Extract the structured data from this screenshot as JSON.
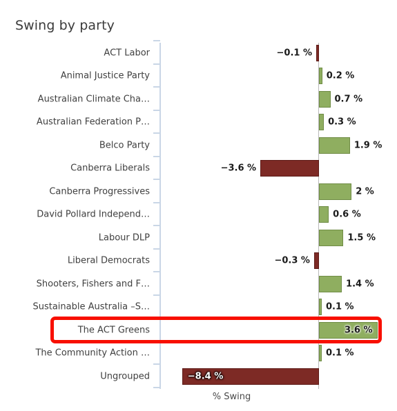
{
  "chart_data": {
    "type": "bar",
    "orientation": "horizontal",
    "title": "Swing by party",
    "xlabel": "% Swing",
    "ylabel": "",
    "grid": false,
    "legend": "none",
    "value_suffix": "%",
    "xlim": [
      -8.4,
      3.6
    ],
    "zero_line": true,
    "colors": {
      "positive": "#8fae60",
      "positive_border": "#6f8c45",
      "negative": "#7d2a25",
      "negative_border": "#5d1b17",
      "axis": "#c9d6e6",
      "zero_line": "#b9b9b9",
      "highlight": "#f80f00",
      "text": "#3f3f3f"
    },
    "highlight_category": "The ACT Greens",
    "categories": [
      "ACT Labor",
      "Animal Justice Party",
      "Australian Climate Cha…",
      "Australian Federation P…",
      "Belco Party",
      "Canberra Liberals",
      "Canberra Progressives",
      "David Pollard Independ…",
      "Labour DLP",
      "Liberal Democrats",
      "Shooters, Fishers and F…",
      "Sustainable Australia –S…",
      "The ACT Greens",
      "The Community Action …",
      "Ungrouped"
    ],
    "values": [
      -0.1,
      0.2,
      0.7,
      0.3,
      1.9,
      -3.6,
      2,
      0.6,
      1.5,
      -0.3,
      1.4,
      0.1,
      3.6,
      0.1,
      -8.4
    ],
    "value_labels": [
      "−0.1 %",
      "0.2 %",
      "0.7 %",
      "0.3 %",
      "1.9 %",
      "−3.6 %",
      "2 %",
      "0.6 %",
      "1.5 %",
      "−0.3 %",
      "1.4 %",
      "0.1 %",
      "3.6 %",
      "0.1 %",
      "−8.4 %"
    ]
  },
  "rows": [
    {
      "label": "ACT Labor",
      "value_label": "−0.1 %"
    },
    {
      "label": "Animal Justice Party",
      "value_label": "0.2 %"
    },
    {
      "label": "Australian Climate Cha…",
      "value_label": "0.7 %"
    },
    {
      "label": "Australian Federation P…",
      "value_label": "0.3 %"
    },
    {
      "label": "Belco Party",
      "value_label": "1.9 %"
    },
    {
      "label": "Canberra Liberals",
      "value_label": "−3.6 %"
    },
    {
      "label": "Canberra Progressives",
      "value_label": "2 %"
    },
    {
      "label": "David Pollard Independ…",
      "value_label": "0.6 %"
    },
    {
      "label": "Labour DLP",
      "value_label": "1.5 %"
    },
    {
      "label": "Liberal Democrats",
      "value_label": "−0.3 %"
    },
    {
      "label": "Shooters, Fishers and F…",
      "value_label": "1.4 %"
    },
    {
      "label": "Sustainable Australia –S…",
      "value_label": "0.1 %"
    },
    {
      "label": "The ACT Greens",
      "value_label": "3.6 %"
    },
    {
      "label": "The Community Action …",
      "value_label": "0.1 %"
    },
    {
      "label": "Ungrouped",
      "value_label": "−8.4 %"
    }
  ]
}
